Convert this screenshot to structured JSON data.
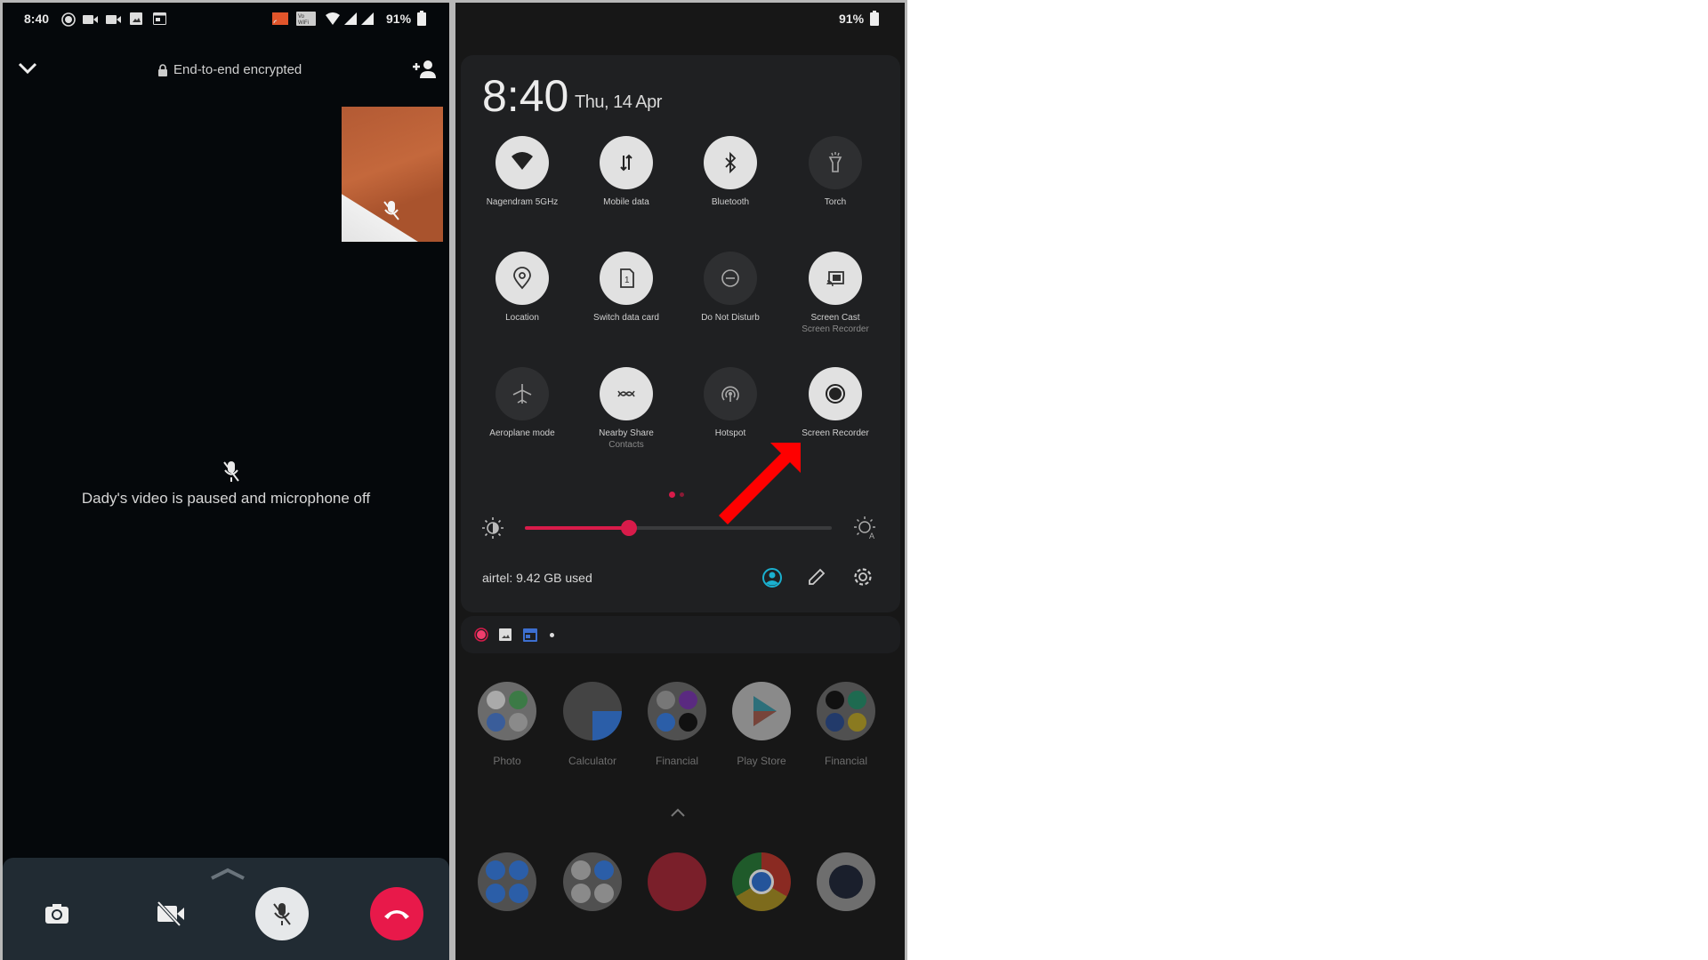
{
  "left_phone": {
    "status_bar": {
      "time": "8:40",
      "left_icons": [
        "record-icon",
        "video-icon",
        "video-icon",
        "image-icon",
        "calendar-icon"
      ],
      "right_icons": [
        "cast-icon",
        "volte-icon",
        "wifi-icon",
        "signal-icon",
        "signal-icon"
      ],
      "battery": "91%"
    },
    "header": {
      "encryption_label": "End-to-end encrypted"
    },
    "remote_status": "Dady's video is paused and microphone off",
    "controls": [
      "flip-camera",
      "video-off",
      "mute",
      "end-call"
    ]
  },
  "right_phone": {
    "status_bar": {
      "battery": "91%"
    },
    "quick_settings": {
      "time": "8:40",
      "date": "Thu, 14 Apr",
      "tiles": [
        {
          "label": "Nagendram 5GHz",
          "sub": "",
          "icon": "wifi-icon",
          "active": true
        },
        {
          "label": "Mobile data",
          "sub": "",
          "icon": "mobile-data-icon",
          "active": true
        },
        {
          "label": "Bluetooth",
          "sub": "",
          "icon": "bluetooth-icon",
          "active": true
        },
        {
          "label": "Torch",
          "sub": "",
          "icon": "torch-icon",
          "active": false
        },
        {
          "label": "Location",
          "sub": "",
          "icon": "location-icon",
          "active": true
        },
        {
          "label": "Switch data card",
          "sub": "",
          "icon": "sim-card-icon",
          "active": true
        },
        {
          "label": "Do Not Disturb",
          "sub": "",
          "icon": "dnd-icon",
          "active": false
        },
        {
          "label": "Screen Cast",
          "sub": "Screen Recorder",
          "icon": "cast-icon",
          "active": true
        },
        {
          "label": "Aeroplane mode",
          "sub": "",
          "icon": "airplane-icon",
          "active": false
        },
        {
          "label": "Nearby Share",
          "sub": "Contacts",
          "icon": "nearby-share-icon",
          "active": true
        },
        {
          "label": "Hotspot",
          "sub": "",
          "icon": "hotspot-icon",
          "active": false
        },
        {
          "label": "Screen Recorder",
          "sub": "",
          "icon": "record-icon",
          "active": true
        }
      ],
      "page_count": 2,
      "current_page": 1,
      "brightness_percent": 34,
      "data_usage": "airtel: 9.42 GB used",
      "accent_color": "#d81b4a"
    },
    "notification_icons": [
      "record-icon",
      "image-icon",
      "calendar-icon",
      "dot"
    ],
    "home_apps_row1": [
      {
        "label": "Photo"
      },
      {
        "label": "Calculator"
      },
      {
        "label": "Financial"
      },
      {
        "label": "Play Store"
      },
      {
        "label": "Financial"
      }
    ],
    "dock_apps": [
      "phone-folder",
      "utilities-folder",
      "authy",
      "chrome",
      "camera"
    ]
  }
}
